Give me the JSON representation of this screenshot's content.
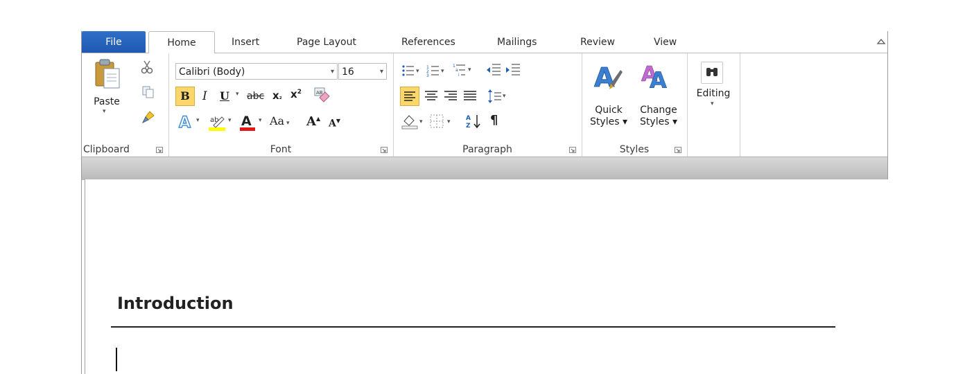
{
  "tabs": [
    "File",
    "Home",
    "Insert",
    "Page Layout",
    "References",
    "Mailings",
    "Review",
    "View"
  ],
  "clipboard": {
    "paste_label": "Paste",
    "group_label": "Clipboard"
  },
  "font": {
    "name": "Calibri (Body)",
    "size": "16",
    "group_label": "Font",
    "change_case_label": "Aa"
  },
  "paragraph": {
    "group_label": "Paragraph"
  },
  "styles": {
    "quick_line1": "Quick",
    "quick_line2": "Styles ▾",
    "change_line1": "Change",
    "change_line2": "Styles ▾",
    "group_label": "Styles"
  },
  "editing": {
    "label": "Editing"
  },
  "document": {
    "heading": "Introduction"
  },
  "colors": {
    "file_tab": "#2b65c0",
    "highlight": "#ffff00",
    "font_color": "#e01818",
    "accent": "#f5c342"
  }
}
